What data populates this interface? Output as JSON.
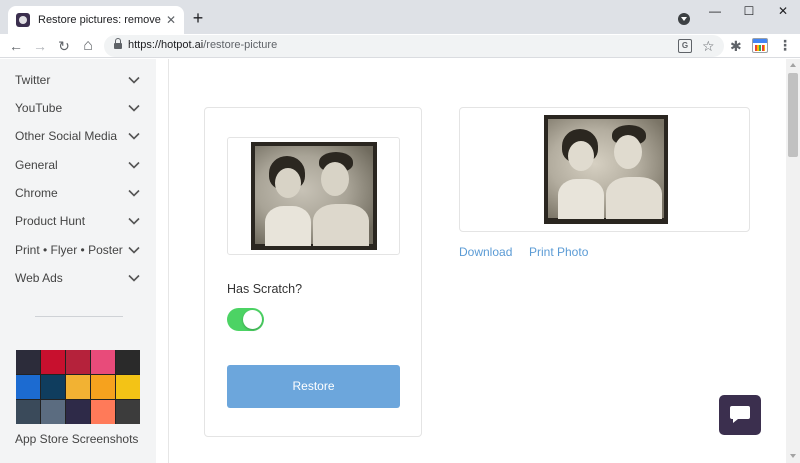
{
  "browser": {
    "tab_title": "Restore pictures: remove scratc",
    "tab_close": "✕",
    "new_tab": "+",
    "url_host": "https://hotpot.ai",
    "url_path": "/restore-picture",
    "translate_glyph": "G",
    "bookmark_star": "☆",
    "extension_glyph": "✱",
    "menu_glyph": "⋮",
    "back_glyph": "←",
    "forward_glyph": "→",
    "reload_glyph": "↻",
    "home_glyph": "⌂",
    "minimize_glyph": "—",
    "maximize_glyph": "☐",
    "close_glyph": "✕"
  },
  "sidebar": {
    "items": [
      {
        "label": "Twitter"
      },
      {
        "label": "YouTube"
      },
      {
        "label": "Other Social Media"
      },
      {
        "label": "General"
      },
      {
        "label": "Chrome"
      },
      {
        "label": "Product Hunt"
      },
      {
        "label": "Print • Flyer • Poster"
      },
      {
        "label": "Web Ads"
      }
    ],
    "thumbnail_label": "App Store Screenshots",
    "thumbnail_colors": [
      "#2c2c3a",
      "#c8102e",
      "#b5223b",
      "#e84b7a",
      "#2a2a2a",
      "#1c6bd1",
      "#0f3d5e",
      "#f2b233",
      "#f6a21e",
      "#f3c316",
      "#3a4a5a",
      "#5b6c80",
      "#2e2a48",
      "#ff7a59",
      "#3c3c3c"
    ]
  },
  "main": {
    "has_scratch_label": "Has Scratch?",
    "has_scratch_on": true,
    "restore_button": "Restore",
    "download_link": "Download",
    "print_link": "Print Photo"
  },
  "colors": {
    "accent_blue": "#6ca6dc",
    "link_blue": "#5b9bd5",
    "toggle_green": "#4cd364",
    "brand_purple": "#3b2f4e"
  }
}
